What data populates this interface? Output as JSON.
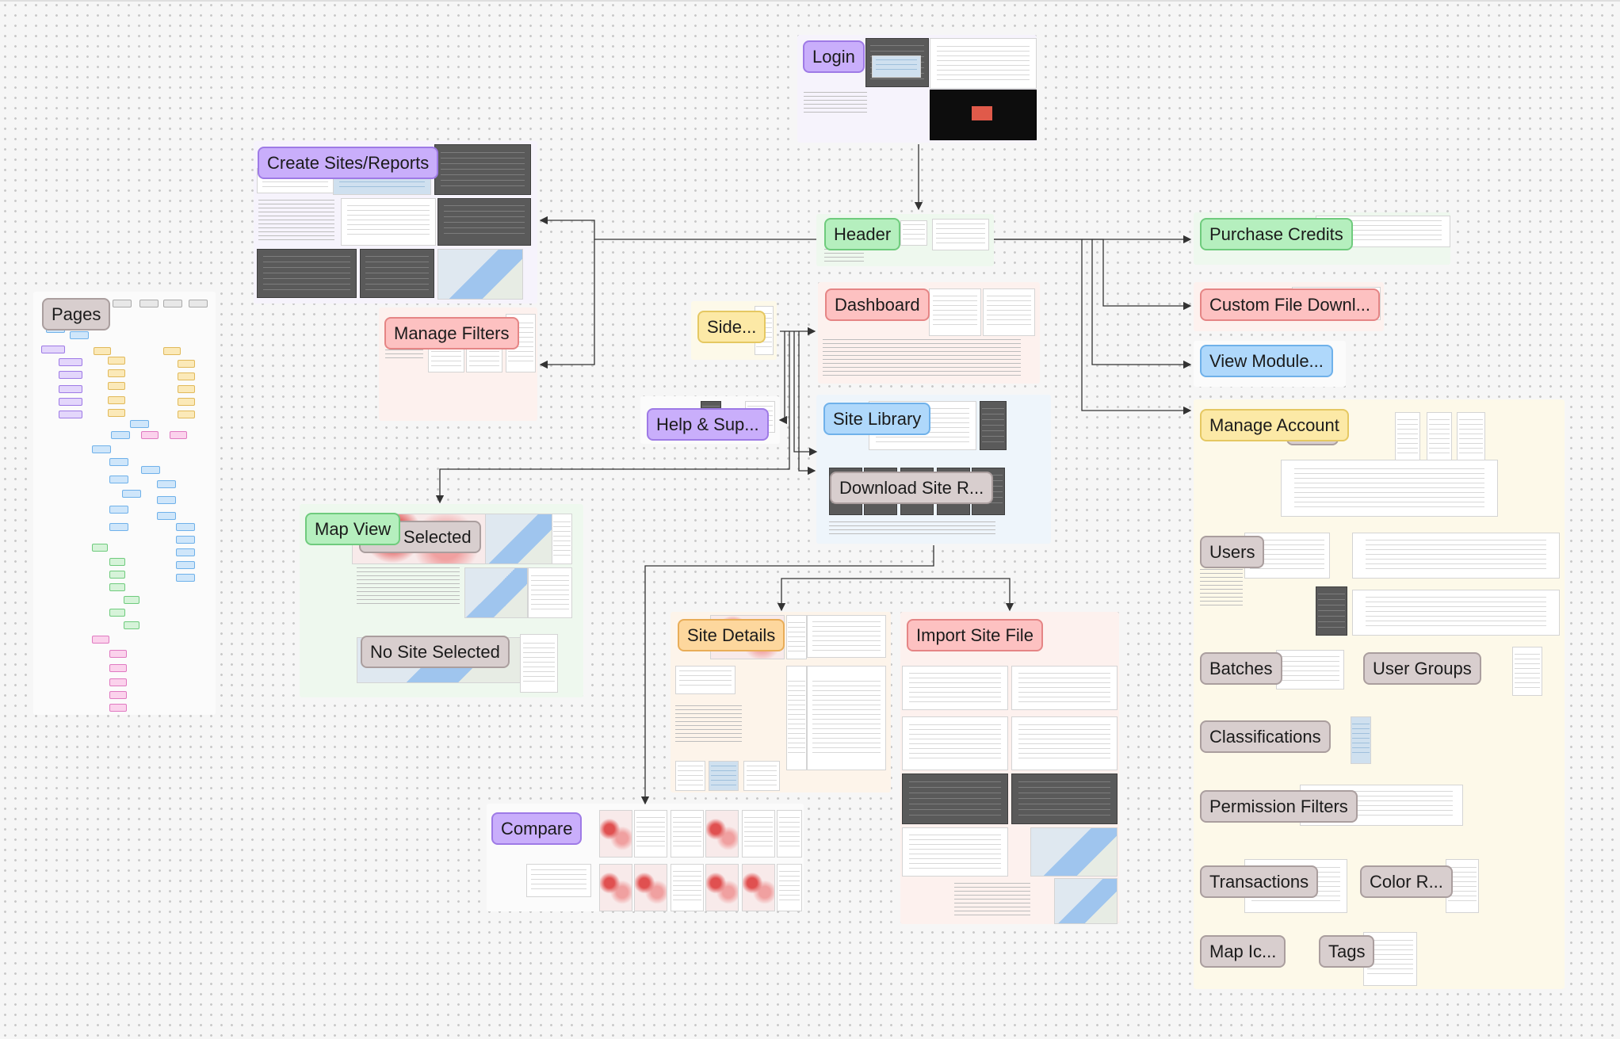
{
  "canvas": {
    "background": "#f6f6f6",
    "dot_color": "#c9c9c9"
  },
  "frames": {
    "login": "Login",
    "create_sites_reports": "Create Sites/Reports",
    "header": "Header",
    "purchase_credits": "Purchase Credits",
    "pages": "Pages",
    "dashboard": "Dashboard",
    "custom_file_download": "Custom File Downl...",
    "side": "Side...",
    "manage_filters": "Manage Filters",
    "view_module": "View Module...",
    "help_support": "Help & Sup...",
    "site_library": "Site Library",
    "manage_account": "Manage Account",
    "manage_account_hidden_suffix": "nt",
    "download_site_reports": "Download Site R...",
    "map_view": "Map View",
    "site_selected": "Site Selected",
    "users": "Users",
    "no_site_selected": "No Site Selected",
    "site_details": "Site Details",
    "import_site_file": "Import Site File",
    "batches": "Batches",
    "user_groups": "User Groups",
    "classifications": "Classifications",
    "permission_filters": "Permission Filters",
    "compare": "Compare",
    "transactions": "Transactions",
    "color_r": "Color R...",
    "map_icons": "Map Ic...",
    "tags": "Tags"
  },
  "label_colors": {
    "purple": "#c9aefb",
    "green": "#b5efbe",
    "red": "#fdc1c1",
    "blue": "#afd8fb",
    "yellow": "#fce9a6",
    "orange": "#fdd79d",
    "grey": "#d8cece"
  }
}
